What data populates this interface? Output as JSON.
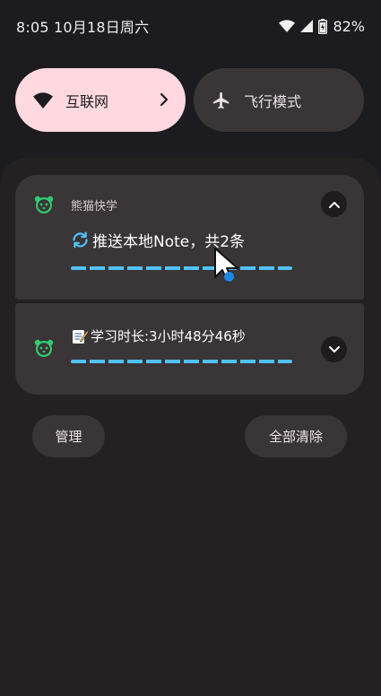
{
  "status_bar": {
    "time_date": "8:05 10月18日周六",
    "battery": "82%"
  },
  "quick_tiles": [
    {
      "label": "互联网",
      "icon": "wifi-icon",
      "active": true
    },
    {
      "label": "飞行模式",
      "icon": "airplane-icon",
      "active": false
    }
  ],
  "notifications": [
    {
      "app_name": "熊猫快学",
      "title": "推送本地Note，共2条",
      "icon": "sync-icon",
      "expanded": true
    },
    {
      "title": "学习时长:3小时48分46秒",
      "icon": "memo-icon",
      "expanded": false
    }
  ],
  "actions": {
    "manage": "管理",
    "clear_all": "全部清除"
  },
  "colors": {
    "accent_tile": "#ffd9df",
    "progress": "#4fc3f7",
    "app_icon": "#2ecc71",
    "touch_dot": "#1e88e5"
  }
}
